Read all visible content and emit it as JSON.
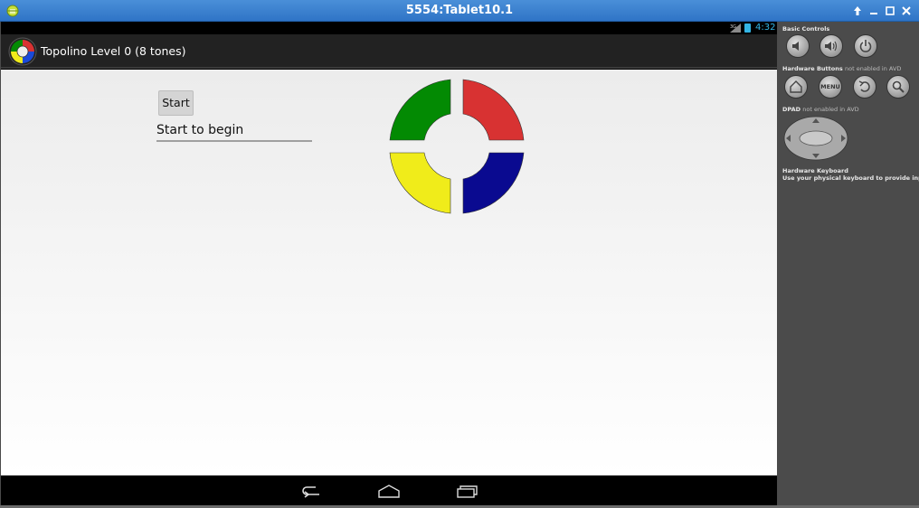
{
  "window": {
    "title": "5554:Tablet10.1",
    "controls": [
      "up-arrow-icon",
      "minimize-icon",
      "maximize-icon",
      "close-icon"
    ]
  },
  "statusbar": {
    "signal_label": "3G",
    "time": "4:32",
    "accent_color": "#33b5e5"
  },
  "actionbar": {
    "title": "Topolino Level 0 (8 tones)"
  },
  "main": {
    "start_label": "Start",
    "status_text": "Start to begin",
    "quadrant_colors": {
      "green": "#038a03",
      "red": "#d83232",
      "yellow": "#f0ec1a",
      "blue": "#0a0a90"
    }
  },
  "navbar": {
    "icons": [
      "back-icon",
      "home-icon",
      "recent-apps-icon"
    ]
  },
  "panel": {
    "basic_controls": "Basic Controls",
    "hardware_buttons": "Hardware Buttons",
    "hardware_buttons_note": "not enabled in AVD",
    "menu_label": "MENU",
    "dpad": "DPAD",
    "dpad_note": "not enabled in AVD",
    "keyboard": "Hardware Keyboard",
    "keyboard_note": "Use your physical keyboard to provide input"
  }
}
